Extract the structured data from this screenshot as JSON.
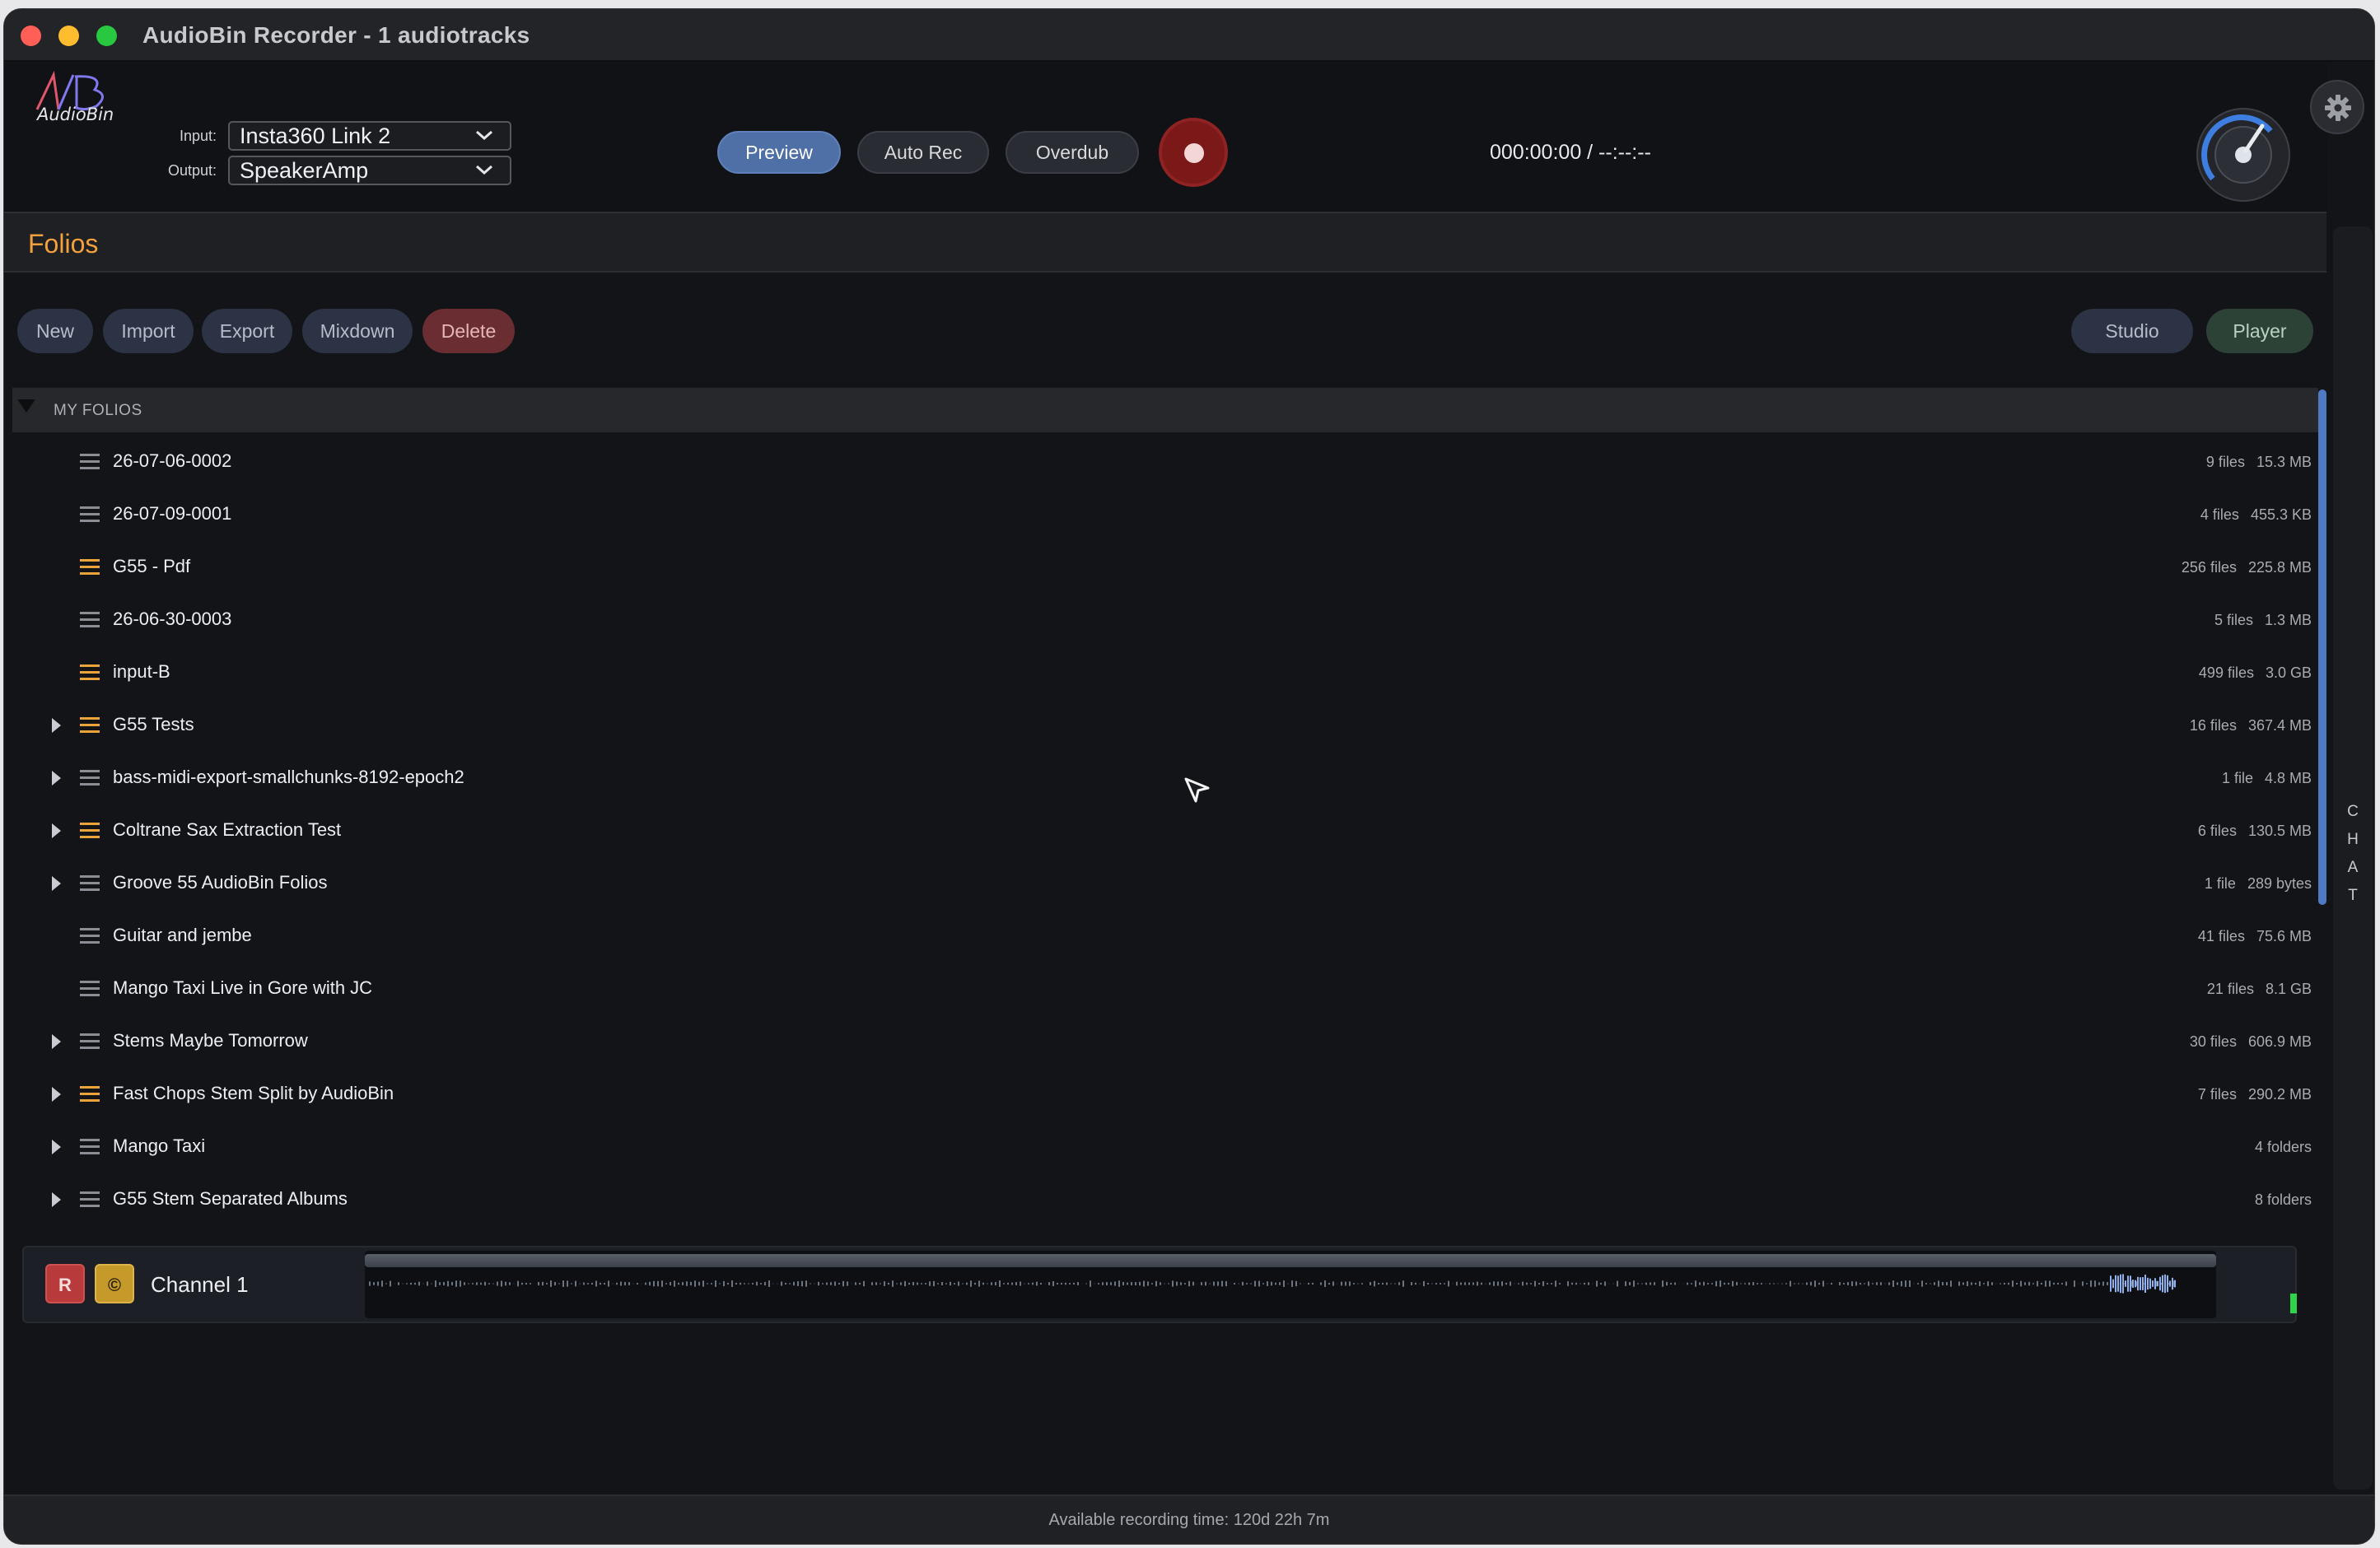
{
  "window": {
    "title": "AudioBin Recorder - 1 audiotracks"
  },
  "logo": {
    "brand": "AudioBin",
    "mark": "AB"
  },
  "io": {
    "input_label": "Input:",
    "input_value": "Insta360 Link 2",
    "output_label": "Output:",
    "output_value": "SpeakerAmp"
  },
  "transport": {
    "preview_label": "Preview",
    "autorec_label": "Auto Rec",
    "overdub_label": "Overdub",
    "timer": "000:00:00 / --:--:--"
  },
  "folios": {
    "title": "Folios",
    "actions": {
      "new": "New",
      "import": "Import",
      "export": "Export",
      "mixdown": "Mixdown",
      "delete": "Delete"
    },
    "views": {
      "studio": "Studio",
      "player": "Player"
    },
    "group_label": "MY FOLIOS",
    "items": [
      {
        "name": "26-07-06-0002",
        "files": "9 files",
        "size": "15.3 MB",
        "expandable": false,
        "highlight": false
      },
      {
        "name": "26-07-09-0001",
        "files": "4 files",
        "size": "455.3 KB",
        "expandable": false,
        "highlight": false
      },
      {
        "name": "G55 - Pdf",
        "files": "256 files",
        "size": "225.8 MB",
        "expandable": false,
        "highlight": true
      },
      {
        "name": "26-06-30-0003",
        "files": "5 files",
        "size": "1.3 MB",
        "expandable": false,
        "highlight": false
      },
      {
        "name": "input-B",
        "files": "499 files",
        "size": "3.0 GB",
        "expandable": false,
        "highlight": true
      },
      {
        "name": "G55 Tests",
        "files": "16 files",
        "size": "367.4 MB",
        "expandable": true,
        "highlight": true
      },
      {
        "name": "bass-midi-export-smallchunks-8192-epoch2",
        "files": "1 file",
        "size": "4.8 MB",
        "expandable": true,
        "highlight": false
      },
      {
        "name": "Coltrane Sax Extraction Test",
        "files": "6 files",
        "size": "130.5 MB",
        "expandable": true,
        "highlight": true
      },
      {
        "name": "Groove 55 AudioBin Folios",
        "files": "1 file",
        "size": "289 bytes",
        "expandable": true,
        "highlight": false
      },
      {
        "name": "Guitar and jembe",
        "files": "41 files",
        "size": "75.6 MB",
        "expandable": false,
        "highlight": false
      },
      {
        "name": "Mango Taxi Live in Gore with JC",
        "files": "21 files",
        "size": "8.1 GB",
        "expandable": false,
        "highlight": false
      },
      {
        "name": "Stems Maybe Tomorrow",
        "files": "30 files",
        "size": "606.9 MB",
        "expandable": true,
        "highlight": false
      },
      {
        "name": "Fast Chops Stem Split by AudioBin",
        "files": "7 files",
        "size": "290.2 MB",
        "expandable": true,
        "highlight": true
      },
      {
        "name": "Mango Taxi",
        "files": "",
        "size": "4 folders",
        "expandable": true,
        "highlight": false
      },
      {
        "name": "G55 Stem Separated Albums",
        "files": "",
        "size": "8 folders",
        "expandable": true,
        "highlight": false
      }
    ]
  },
  "channel": {
    "name": "Channel 1",
    "rec_label": "R",
    "c_label": "©"
  },
  "chat": {
    "letters": [
      "C",
      "H",
      "A",
      "T"
    ]
  },
  "status": {
    "text": "Available recording time: 120d 22h 7m"
  },
  "colors": {
    "accent_orange": "#f4a03c",
    "preview_blue": "#4f6fa7",
    "record_red": "#7b1818",
    "menu_gold": "#eba43c"
  }
}
